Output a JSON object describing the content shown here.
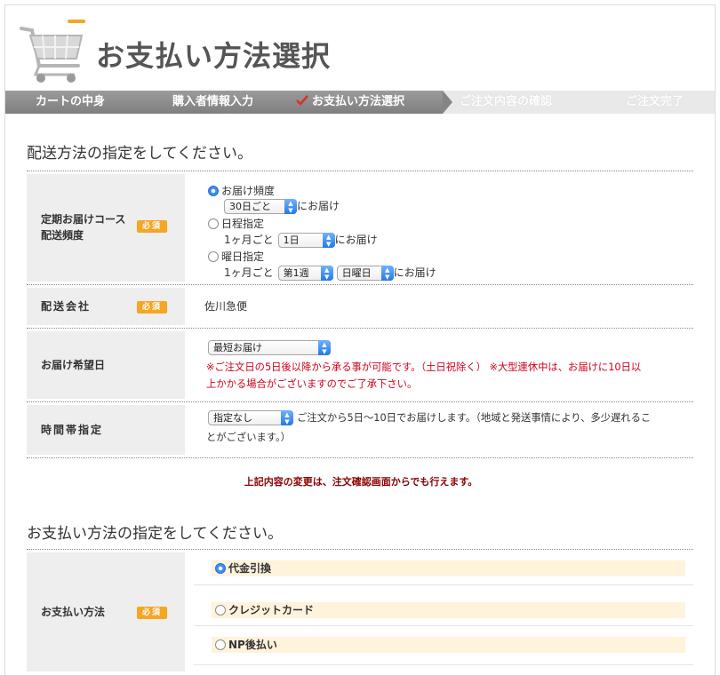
{
  "header": {
    "title": "お支払い方法選択"
  },
  "steps": [
    {
      "label": "カートの中身",
      "state": "done"
    },
    {
      "label": "購入者情報入力",
      "state": "done"
    },
    {
      "label": "お支払い方法選択",
      "state": "current"
    },
    {
      "label": "ご注文内容の確認",
      "state": "todo"
    },
    {
      "label": "ご注文完了",
      "state": "todo"
    }
  ],
  "shipping": {
    "title": "配送方法の指定をしてください。",
    "required_badge": "必須",
    "frequency": {
      "label_line1": "定期お届けコース",
      "label_line2": "配送頻度",
      "opt1_label": "お届け頻度",
      "opt1_select": "30日ごと",
      "opt1_suffix": "にお届け",
      "opt2_label": "日程指定",
      "opt2_prefix": "1ヶ月ごと",
      "opt2_select": "1日",
      "opt2_suffix": "にお届け",
      "opt3_label": "曜日指定",
      "opt3_prefix": "1ヶ月ごと",
      "opt3_select_week": "第1週",
      "opt3_select_day": "日曜日",
      "opt3_suffix": "にお届け"
    },
    "carrier": {
      "label": "配送会社",
      "value": "佐川急便"
    },
    "desired_date": {
      "label": "お届け希望日",
      "select": "最短お届け",
      "note_line1": "※ご注文日の5日後以降から承る事が可能です。（土日祝除く） ※大型連休中は、お届けに10日以",
      "note_line2": "上かかる場合がございますのでご了承下さい。"
    },
    "time_slot": {
      "label": "時間帯指定",
      "select": "指定なし",
      "note_line1": "ご注文から5日〜10日でお届けします。（地域と発送事情により、多少遅れるこ",
      "note_line2": "とがございます。）"
    },
    "notice": "上記内容の変更は、注文確認画面からでも行えます。"
  },
  "payment": {
    "title": "お支払い方法の指定をしてください。",
    "label": "お支払い方法",
    "required_badge": "必須",
    "options": [
      {
        "label": "代金引換",
        "selected": true
      },
      {
        "label": "クレジットカード",
        "selected": false
      },
      {
        "label": "NP後払い",
        "selected": false
      }
    ]
  },
  "colors": {
    "badge": "#f5a623",
    "error": "#d0021b",
    "notice": "#8b0000",
    "option_bg": "#fff3dc"
  }
}
